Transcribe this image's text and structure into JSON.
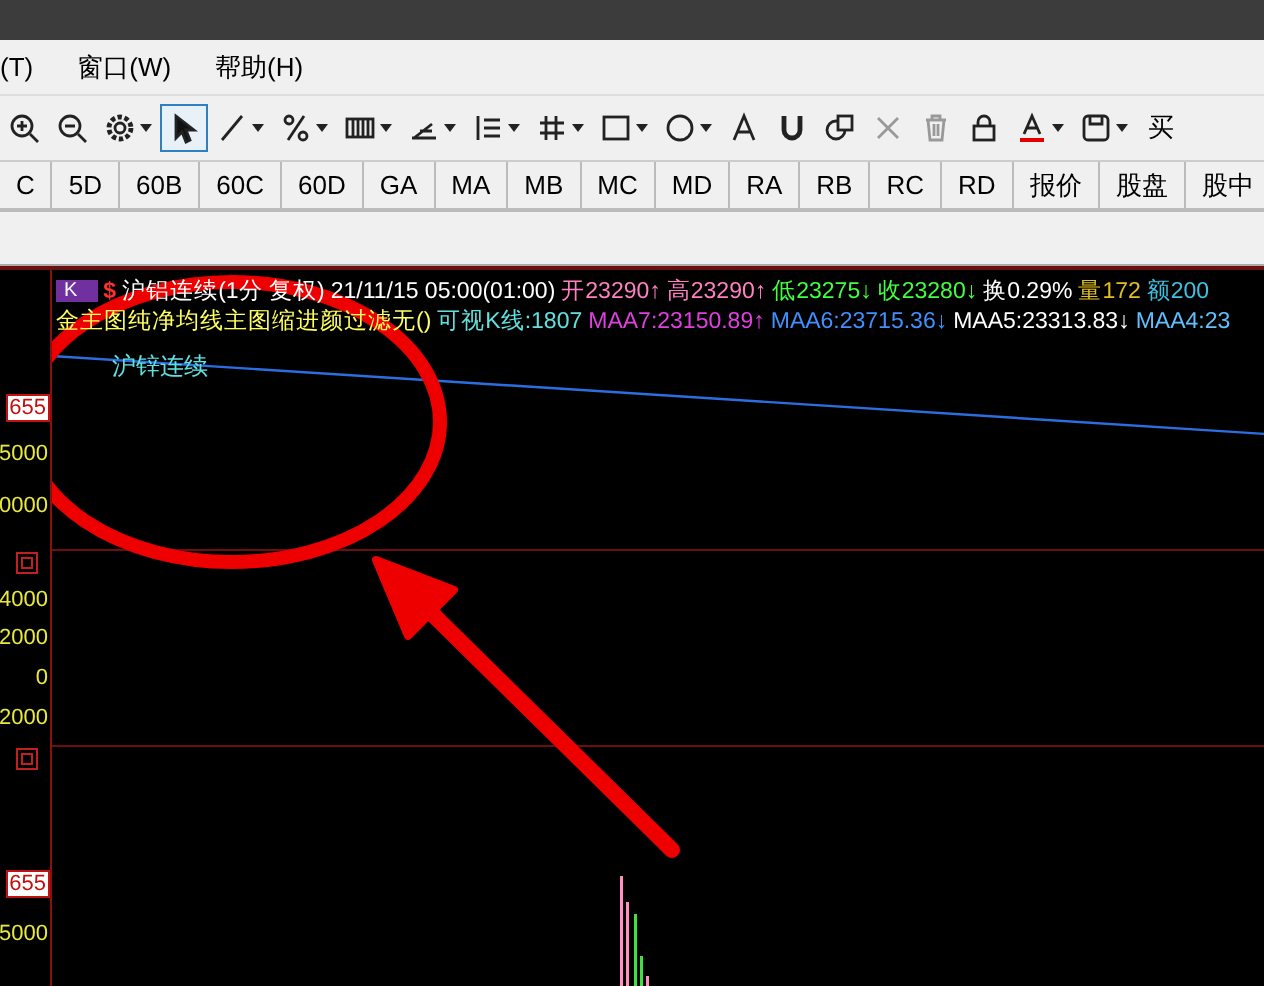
{
  "menu": [
    {
      "label": "(T)"
    },
    {
      "label": "窗口(W)"
    },
    {
      "label": "帮助(H)"
    }
  ],
  "tools": [
    {
      "kind": "zoom-in",
      "selected": false,
      "dropdown": false
    },
    {
      "kind": "zoom-out",
      "selected": false,
      "dropdown": false
    },
    {
      "kind": "gear",
      "selected": false,
      "dropdown": true
    },
    {
      "kind": "cursor",
      "selected": true,
      "dropdown": false
    },
    {
      "kind": "line",
      "selected": false,
      "dropdown": true
    },
    {
      "kind": "percent",
      "selected": false,
      "dropdown": true
    },
    {
      "kind": "bars",
      "selected": false,
      "dropdown": true
    },
    {
      "kind": "angle",
      "selected": false,
      "dropdown": true
    },
    {
      "kind": "levels",
      "selected": false,
      "dropdown": true
    },
    {
      "kind": "grid",
      "selected": false,
      "dropdown": true
    },
    {
      "kind": "rect",
      "selected": false,
      "dropdown": true
    },
    {
      "kind": "circle",
      "selected": false,
      "dropdown": true
    },
    {
      "kind": "text",
      "selected": false,
      "dropdown": false
    },
    {
      "kind": "magnet",
      "selected": false,
      "dropdown": false
    },
    {
      "kind": "copy",
      "selected": false,
      "dropdown": false
    },
    {
      "kind": "delete",
      "selected": false,
      "dropdown": false
    },
    {
      "kind": "trash",
      "selected": false,
      "dropdown": false
    },
    {
      "kind": "lock",
      "selected": false,
      "dropdown": false
    },
    {
      "kind": "font-color",
      "selected": false,
      "dropdown": true
    },
    {
      "kind": "save",
      "selected": false,
      "dropdown": true
    }
  ],
  "buy_label": "买",
  "periods": [
    {
      "label": "C"
    },
    {
      "label": "5D"
    },
    {
      "label": "60B"
    },
    {
      "label": "60C"
    },
    {
      "label": "60D"
    },
    {
      "label": "GA"
    },
    {
      "label": "MA"
    },
    {
      "label": "MB"
    },
    {
      "label": "MC"
    },
    {
      "label": "MD"
    },
    {
      "label": "RA"
    },
    {
      "label": "RB"
    },
    {
      "label": "RC"
    },
    {
      "label": "RD"
    },
    {
      "label": "报价"
    },
    {
      "label": "股盘"
    },
    {
      "label": "股中"
    }
  ],
  "chart": {
    "badge": "K",
    "currency": "$",
    "info_line": [
      {
        "text": "沪铝连续(1分 复权)",
        "color": "#ffffff"
      },
      {
        "text": "21/11/15 05:00(01:00)",
        "color": "#ffffff"
      },
      {
        "text": "开23290↑",
        "color": "#ff80c0"
      },
      {
        "text": "高23290↑",
        "color": "#ff80c0"
      },
      {
        "text": "低23275↓",
        "color": "#40ff40"
      },
      {
        "text": "收23280↓",
        "color": "#40ff40"
      },
      {
        "text": "换0.29%",
        "color": "#ffffff"
      },
      {
        "text": "量172",
        "color": "#e0c020"
      },
      {
        "text": "额200",
        "color": "#40c0e0"
      }
    ],
    "ma_line": [
      {
        "text": "金主图纯净均线主图缩进颜过滤无()",
        "color": "#ffff60"
      },
      {
        "text": "可视K线:1807",
        "color": "#60e0e0"
      },
      {
        "text": "MAA7:23150.89↑",
        "color": "#e040e0"
      },
      {
        "text": "MAA6:23715.36↓",
        "color": "#4090ff"
      },
      {
        "text": "MAA5:23313.83↓",
        "color": "#ffffff"
      },
      {
        "text": "MAA4:23",
        "color": "#60c0ff"
      }
    ],
    "overlay_label": "沪锌连续",
    "axis": [
      {
        "kind": "tag",
        "text": "655"
      },
      {
        "kind": "value",
        "text": "5000"
      },
      {
        "kind": "value",
        "text": "0000"
      },
      {
        "kind": "icon"
      },
      {
        "kind": "value",
        "text": "4000"
      },
      {
        "kind": "value",
        "text": "2000"
      },
      {
        "kind": "value",
        "text": "0"
      },
      {
        "kind": "value",
        "text": "2000"
      },
      {
        "kind": "icon"
      },
      {
        "kind": "tag",
        "text": "655"
      },
      {
        "kind": "value",
        "text": "5000"
      }
    ]
  }
}
